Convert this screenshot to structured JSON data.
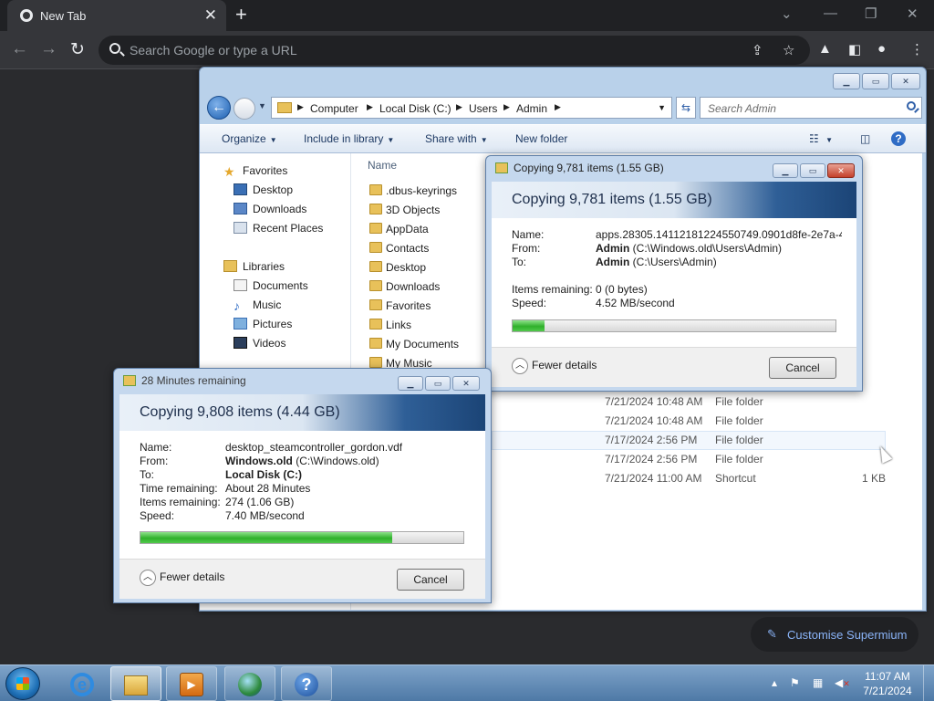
{
  "browser": {
    "tab_title": "New Tab",
    "omnibox_placeholder": "Search Google or type a URL"
  },
  "explorer": {
    "breadcrumbs": [
      "Computer",
      "Local Disk (C:)",
      "Users",
      "Admin"
    ],
    "search_placeholder": "Search Admin",
    "commands": [
      "Organize",
      "Include in library",
      "Share with",
      "New folder"
    ],
    "nav": {
      "favorites_header": "Favorites",
      "favorites": [
        "Desktop",
        "Downloads",
        "Recent Places"
      ],
      "libraries_header": "Libraries",
      "libraries": [
        "Documents",
        "Music",
        "Pictures",
        "Videos"
      ]
    },
    "name_column": "Name",
    "files": [
      ".dbus-keyrings",
      "3D Objects",
      "AppData",
      "Contacts",
      "Desktop",
      "Downloads",
      "Favorites",
      "Links",
      "My Documents",
      "My Music"
    ],
    "detail_rows": [
      {
        "date": "7/21/2024 10:48 AM",
        "type": "File folder",
        "size": ""
      },
      {
        "date": "7/21/2024 10:48 AM",
        "type": "File folder",
        "size": ""
      },
      {
        "date": "7/17/2024 2:56 PM",
        "type": "File folder",
        "size": ""
      },
      {
        "date": "7/17/2024 2:56 PM",
        "type": "File folder",
        "size": ""
      },
      {
        "date": "7/21/2024 11:00 AM",
        "type": "Shortcut",
        "size": "1 KB"
      }
    ]
  },
  "copy_dialog_front": {
    "window_title": "Copying 9,781 items (1.55 GB)",
    "header_title": "Copying 9,781 items (1.55 GB)",
    "labels": {
      "name": "Name:",
      "from": "From:",
      "to": "To:",
      "items_remaining": "Items remaining:",
      "speed": "Speed:"
    },
    "name": "apps.28305.14112181224550749.0901d8fe-2e7a-4...",
    "from_bold": "Admin",
    "from_rest": " (C:\\Windows.old\\Users\\Admin)",
    "to_bold": "Admin",
    "to_rest": " (C:\\Users\\Admin)",
    "items_remaining": "0 (0 bytes)",
    "speed": "4.52 MB/second",
    "progress": 0.1,
    "fewer_details": "Fewer details",
    "cancel": "Cancel"
  },
  "copy_dialog_back": {
    "window_title": "28 Minutes remaining",
    "header_title": "Copying 9,808 items (4.44 GB)",
    "labels": {
      "name": "Name:",
      "from": "From:",
      "to": "To:",
      "time_remaining": "Time remaining:",
      "items_remaining": "Items remaining:",
      "speed": "Speed:"
    },
    "name": "desktop_steamcontroller_gordon.vdf",
    "from_bold": "Windows.old",
    "from_rest": " (C:\\Windows.old)",
    "to_bold": "Local Disk (C:)",
    "to_rest": "",
    "time_remaining": "About 28 Minutes",
    "items_remaining": "274 (1.06 GB)",
    "speed": "7.40 MB/second",
    "progress": 0.78,
    "fewer_details": "Fewer details",
    "cancel": "Cancel"
  },
  "customise_label": "Customise Supermium",
  "taskbar": {
    "time": "11:07 AM",
    "date": "7/21/2024"
  }
}
